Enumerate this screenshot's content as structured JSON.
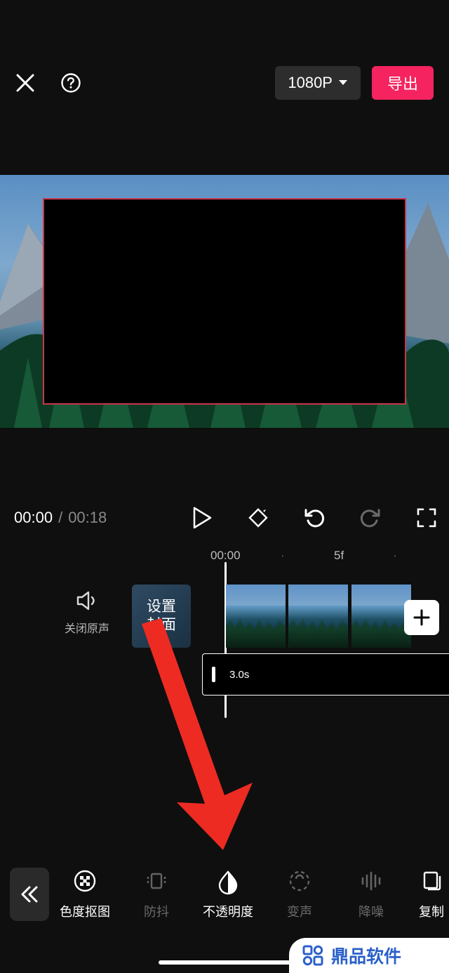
{
  "header": {
    "resolution_label": "1080P",
    "export_label": "导出"
  },
  "time": {
    "current": "00:00",
    "separator": "/",
    "duration": "00:18"
  },
  "ruler": {
    "t0": "00:00",
    "t1": "5f"
  },
  "track": {
    "mute_label": "关闭原声",
    "cover_line1": "设置",
    "cover_line2": "封面",
    "clip_duration": "3.0s"
  },
  "toolbar": {
    "items": [
      {
        "label": "色度抠图",
        "dim": false
      },
      {
        "label": "防抖",
        "dim": true
      },
      {
        "label": "不透明度",
        "dim": false
      },
      {
        "label": "变声",
        "dim": true
      },
      {
        "label": "降噪",
        "dim": true
      },
      {
        "label": "复制",
        "dim": false
      }
    ]
  },
  "footer": {
    "brand": "鼎品软件"
  }
}
